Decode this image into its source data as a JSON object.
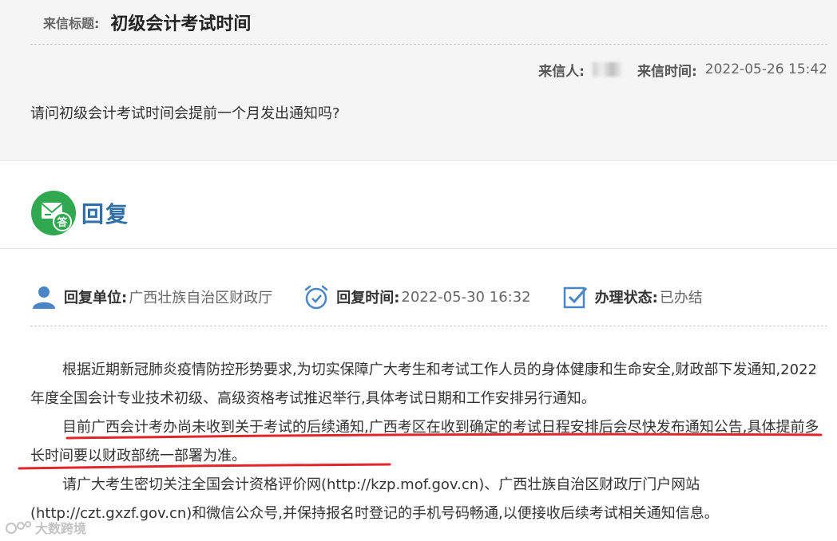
{
  "letter": {
    "subject_label": "来信标题:",
    "subject": "初级会计考试时间",
    "sender_label": "来信人:",
    "time_label": "来信时间:",
    "time": "2022-05-26 15:42",
    "question": "请问初级会计考试时间会提前一个月发出通知吗?"
  },
  "reply": {
    "title": "回复",
    "icon_badge": "答",
    "unit_label": "回复单位:",
    "unit": "广西壮族自治区财政厅",
    "time_label": "回复时间:",
    "time": "2022-05-30 16:32",
    "status_label": "办理状态:",
    "status": "已办结",
    "paragraphs": [
      "根据近期新冠肺炎疫情防控形势要求,为切实保障广大考生和考试工作人员的身体健康和生命安全,财政部下发通知,2022年度全国会计专业技术初级、高级资格考试推迟举行,具体考试日期和工作安排另行通知。",
      "目前广西会计考办尚未收到关于考试的后续通知,广西考区在收到确定的考试日程安排后会尽快发布通知公告,具体提前多长时间要以财政部统一部署为准。",
      "请广大考生密切关注全国会计资格评价网(http://kzp.mof.gov.cn)、广西壮族自治区财政厅门户网站(http://czt.gxzf.gov.cn)和微信公众号,并保持报名时登记的手机号码畅通,以便接收后续考试相关通知信息。"
    ]
  },
  "watermark": "大数跨境",
  "colors": {
    "accent_green": "#2fa84f",
    "reply_blue": "#2f6fa8",
    "info_blue": "#4a86c5",
    "annotation_red": "#e0262b"
  }
}
